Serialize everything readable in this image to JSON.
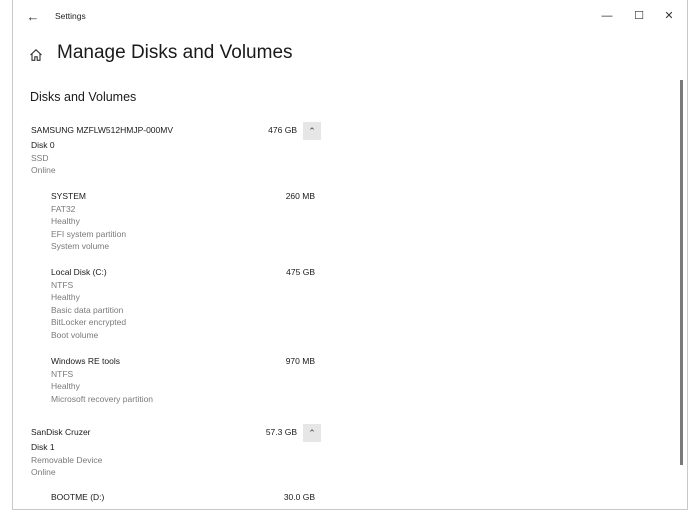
{
  "window": {
    "title": "Settings",
    "back_glyph": "←",
    "minimize_glyph": "—",
    "maximize_glyph": "☐",
    "close_glyph": "✕"
  },
  "header": {
    "title": "Manage Disks and Volumes",
    "home_icon": "home-icon"
  },
  "section": {
    "title": "Disks and Volumes"
  },
  "disks": [
    {
      "name": "SAMSUNG MZFLW512HMJP-000MV",
      "size": "476 GB",
      "disk_label": "Disk 0",
      "type": "SSD",
      "status": "Online",
      "collapse_glyph": "⌃",
      "volumes": [
        {
          "name": "SYSTEM",
          "size": "260 MB",
          "details": [
            "FAT32",
            "Healthy",
            "EFI system partition",
            "System volume"
          ]
        },
        {
          "name": "Local Disk (C:)",
          "size": "475 GB",
          "details": [
            "NTFS",
            "Healthy",
            "Basic data partition",
            "BitLocker encrypted",
            "Boot volume"
          ]
        },
        {
          "name": "Windows RE tools",
          "size": "970 MB",
          "details": [
            "NTFS",
            "Healthy",
            "Microsoft recovery partition"
          ]
        }
      ]
    },
    {
      "name": "SanDisk Cruzer",
      "size": "57.3 GB",
      "disk_label": "Disk 1",
      "type": "Removable Device",
      "status": "Online",
      "collapse_glyph": "⌃",
      "volumes": [
        {
          "name": "BOOTME (D:)",
          "size": "30.0 GB",
          "details": []
        }
      ]
    }
  ]
}
